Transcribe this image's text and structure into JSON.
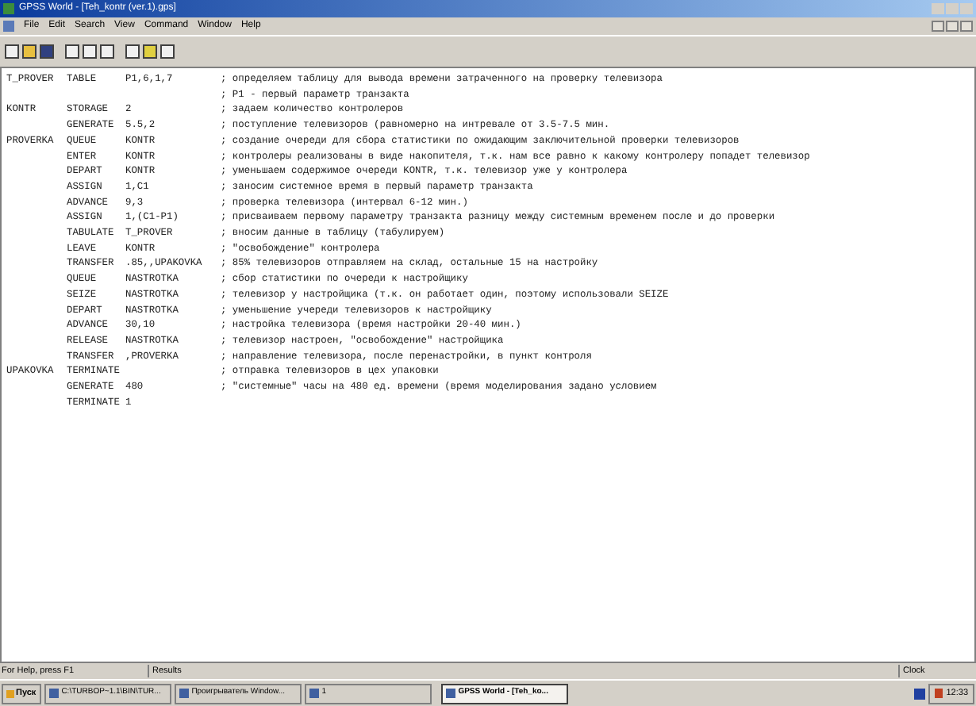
{
  "window": {
    "title": "GPSS World - [Teh_kontr (ver.1).gps]"
  },
  "menu": [
    "File",
    "Edit",
    "Search",
    "View",
    "Command",
    "Window",
    "Help"
  ],
  "code_lines": [
    {
      "label": "T_PROVER",
      "op": "TABLE",
      "operand": "P1,6,1,7",
      "comment": "; определяем таблицу для вывода времени затраченного на проверку телевизора"
    },
    {
      "comment": "; P1 - первый параметр транзакта"
    },
    {
      "label": "KONTR",
      "op": "STORAGE",
      "operand": "2",
      "comment": "; задаем количество контролеров"
    },
    {
      "op": "GENERATE",
      "operand": "5.5,2",
      "comment": "; поступление телевизоров (равномерно на интревале от 3.5-7.5 мин."
    },
    {
      "label": "PROVERKA",
      "op": "QUEUE",
      "operand": "KONTR",
      "comment": "; создание очереди для сбора статистики по ожидающим заключительной проверки телевизоров"
    },
    {
      "op": "ENTER",
      "operand": "KONTR",
      "comment": "; контролеры реализованы в виде накопителя, т.к. нам все равно к какому контролеру попадет телевизор"
    },
    {
      "op": "DEPART",
      "operand": "KONTR",
      "comment": "; уменьшаем содержимое очереди KONTR, т.к. телевизор уже у контролера"
    },
    {
      "op": "ASSIGN",
      "operand": "1,C1",
      "comment": "; заносим системное время в первый параметр транзакта"
    },
    {
      "op": "ADVANCE",
      "operand": "9,3",
      "comment": "; проверка телевизора (интервал 6-12 мин.)"
    },
    {
      "op": "ASSIGN",
      "operand": "1,(C1-P1)",
      "comment": "; присваиваем первому параметру транзакта разницу между системным временем после и до проверки"
    },
    {
      "op": "TABULATE",
      "operand": "T_PROVER",
      "comment": "; вносим данные в таблицу (табулируем)"
    },
    {
      "op": "LEAVE",
      "operand": "KONTR",
      "comment": "; \"освобождение\" контролера"
    },
    {
      "op": "TRANSFER",
      "operand": ".85,,UPAKOVKA",
      "comment": "; 85% телевизоров отправляем на склад, остальные 15 на настройку"
    },
    {
      "op": "QUEUE",
      "operand": "NASTROTKA",
      "comment": "; сбор статистики по очереди к настройщику"
    },
    {
      "op": "SEIZE",
      "operand": "NASTROTKA",
      "comment": "; телевизор у настройщика (т.к. он работает один, поэтому использовали SEIZE"
    },
    {
      "op": "DEPART",
      "operand": "NASTROTKA",
      "comment": "; уменьшение учереди телевизоров к настройщику"
    },
    {
      "op": "ADVANCE",
      "operand": "30,10",
      "comment": "; настройка телевизора (время настройки 20-40 мин.)"
    },
    {
      "op": "RELEASE",
      "operand": "NASTROTKA",
      "comment": "; телевизор настроен, \"освобождение\" настройщика"
    },
    {
      "op": "TRANSFER",
      "operand": ",PROVERKA",
      "comment": "; направление телевизора, после перенастройки, в пункт контроля"
    },
    {
      "label": "UPAKOVKA",
      "op": "TERMINATE",
      "comment": "; отправка телевизоров в цех упаковки"
    },
    {
      "op": "GENERATE",
      "operand": "480",
      "comment": "; \"системные\" часы на 480 ед. времени (время моделирования задано условием"
    },
    {
      "op": "TERMINATE",
      "operand": "1"
    }
  ],
  "status_bar": [
    "For Help, press F1",
    "Results",
    "Clock"
  ],
  "taskbar": {
    "start": "Пуск",
    "items": [
      {
        "label": "C:\\TURBOP~1.1\\BIN\\TUR...",
        "selected": false
      },
      {
        "label": "Проигрыватель Window...",
        "selected": false
      },
      {
        "label": "1",
        "selected": false
      },
      {
        "label": "GPSS World - [Teh_ko...",
        "selected": true
      }
    ],
    "clock": "12:33"
  }
}
